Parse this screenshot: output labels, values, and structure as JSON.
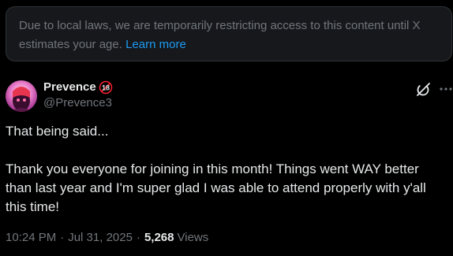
{
  "notice": {
    "text": "Due to local laws, we are temporarily restricting access to this content until X estimates your age.",
    "link_label": "Learn more"
  },
  "post": {
    "author_name": "Prevence",
    "age_badge_label": "18",
    "author_handle": "@Prevence3",
    "body_lines": [
      "That being said...",
      "Thank you everyone for joining in this month! Things went WAY better than last year and I'm super glad I was able to attend properly with y'all this time!"
    ],
    "time": "10:24 PM",
    "date": "Jul 31, 2025",
    "separator": "·",
    "views_count": "5,268",
    "views_label": "Views"
  },
  "icons": {
    "grok": "grok-icon",
    "more": "more-icon",
    "age_badge": "age-restriction-18-icon",
    "avatar": "avatar"
  },
  "colors": {
    "background": "#000000",
    "notice_bg": "#16181c",
    "link": "#1d9bf0",
    "secondary_text": "#71767b",
    "primary_text": "#e7e9ea",
    "badge_red": "#f4212e"
  }
}
